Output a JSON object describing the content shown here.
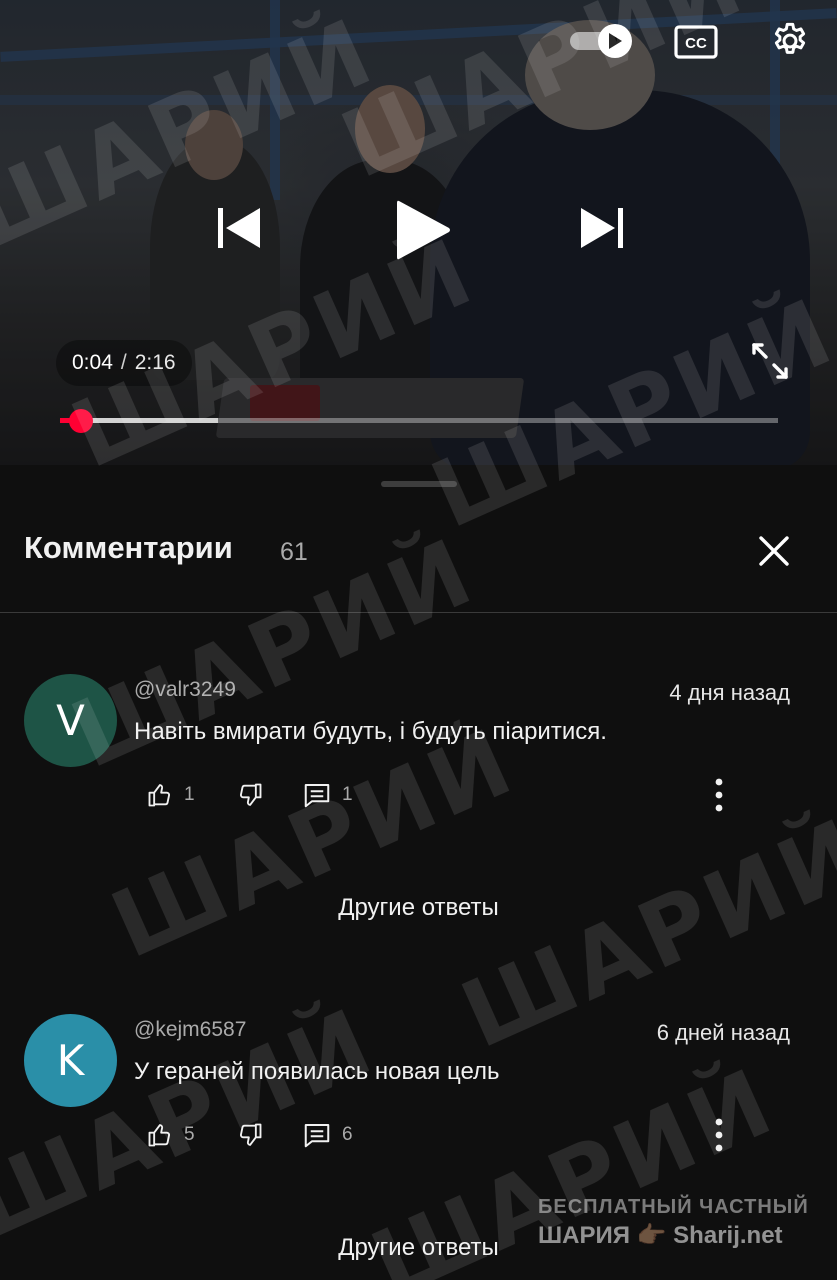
{
  "player": {
    "current_time": "0:04",
    "separator": "/",
    "duration": "2:16",
    "progress_fraction": 0.029,
    "buffered_fraction": 0.22,
    "cc_label": "CC"
  },
  "comments_panel": {
    "title": "Комментарии",
    "count": "61"
  },
  "comments": [
    {
      "avatar_letter": "V",
      "avatar_color": "#1e5446",
      "author": "@valr3249",
      "date": "4 дня назад",
      "text": "Навіть вмирати будуть, і будуть піаритися.",
      "likes": "1",
      "replies": "1",
      "more_replies_label": "Другие ответы"
    },
    {
      "avatar_letter": "K",
      "avatar_color": "#2a8fa8",
      "author": "@kejm6587",
      "date": "6 дней назад",
      "text": "У гераней появилась новая цель",
      "likes": "5",
      "replies": "6",
      "more_replies_label": "Другие ответы"
    }
  ],
  "watermark": {
    "text": "ШАРИЙ",
    "brand_line1": "БЕСПЛАТНЫЙ  ЧАСТНЫЙ",
    "brand_line2": "ШАРИЯ 👉🏽 Sharij.net"
  },
  "colors": {
    "accent_red": "#ff0033",
    "background": "#0f0f0f"
  }
}
